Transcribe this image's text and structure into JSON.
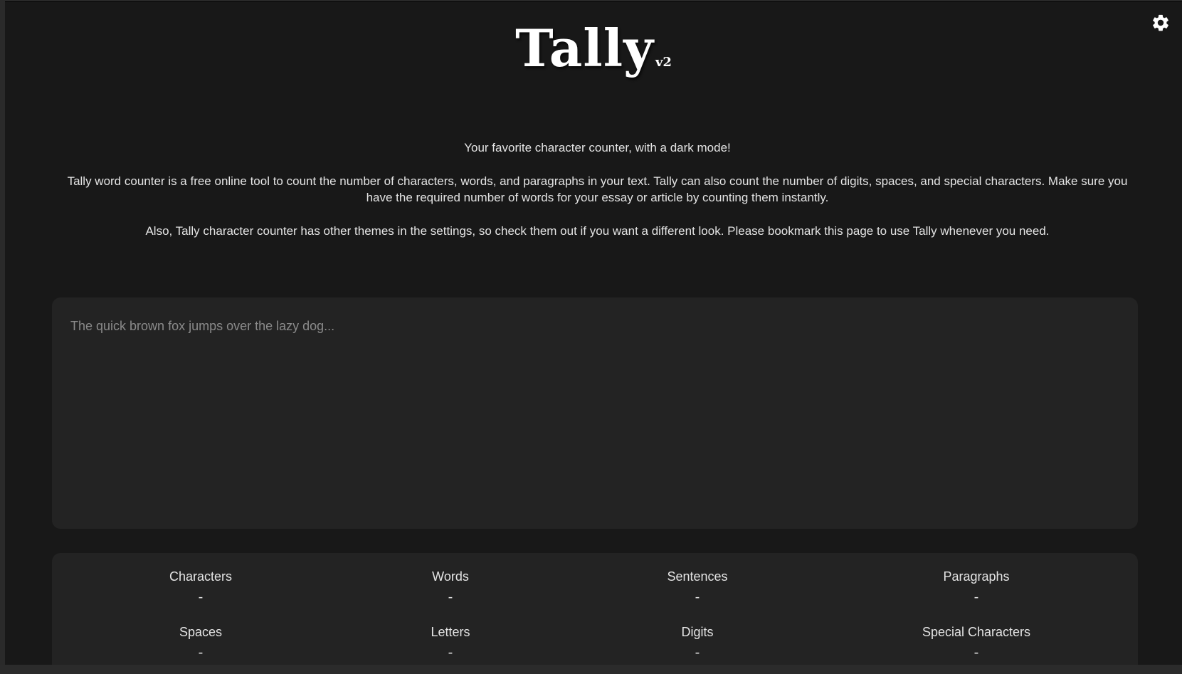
{
  "app": {
    "title": "Tally",
    "version": "v2"
  },
  "settings": {
    "icon": "gear-icon"
  },
  "intro": {
    "tagline": "Your favorite character counter, with a dark mode!",
    "description": "Tally word counter is a free online tool to count the number of characters, words, and paragraphs in your text. Tally can also count the number of digits, spaces, and special characters. Make sure you have the required number of words for your essay or article by counting them instantly.",
    "themes_note": "Also, Tally character counter has other themes in the settings, so check them out if you want a different look. Please bookmark this page to use Tally whenever you need."
  },
  "editor": {
    "placeholder": "The quick brown fox jumps over the lazy dog...",
    "value": ""
  },
  "stats": [
    {
      "label": "Characters",
      "value": "-"
    },
    {
      "label": "Words",
      "value": "-"
    },
    {
      "label": "Sentences",
      "value": "-"
    },
    {
      "label": "Paragraphs",
      "value": "-"
    },
    {
      "label": "Spaces",
      "value": "-"
    },
    {
      "label": "Letters",
      "value": "-"
    },
    {
      "label": "Digits",
      "value": "-"
    },
    {
      "label": "Special Characters",
      "value": "-"
    }
  ],
  "colors": {
    "background": "#181818",
    "panel": "#232323",
    "text": "#e4e4e4",
    "placeholder": "#8a8a8a"
  }
}
